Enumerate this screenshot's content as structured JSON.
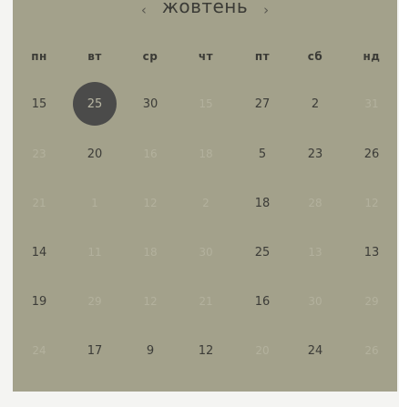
{
  "header": {
    "prev_label": "‹",
    "next_label": "›",
    "month": "жовтень"
  },
  "weekdays": [
    "пн",
    "вт",
    "ср",
    "чт",
    "пт",
    "сб",
    "нд"
  ],
  "weeks": [
    [
      {
        "d": "15",
        "m": false
      },
      {
        "d": "25",
        "m": false,
        "sel": true
      },
      {
        "d": "30",
        "m": false
      },
      {
        "d": "15",
        "m": true
      },
      {
        "d": "27",
        "m": false
      },
      {
        "d": "2",
        "m": false
      },
      {
        "d": "31",
        "m": true
      }
    ],
    [
      {
        "d": "23",
        "m": true
      },
      {
        "d": "20",
        "m": false
      },
      {
        "d": "16",
        "m": true
      },
      {
        "d": "18",
        "m": true
      },
      {
        "d": "5",
        "m": false
      },
      {
        "d": "23",
        "m": false
      },
      {
        "d": "26",
        "m": false
      }
    ],
    [
      {
        "d": "21",
        "m": true
      },
      {
        "d": "1",
        "m": true
      },
      {
        "d": "12",
        "m": true
      },
      {
        "d": "2",
        "m": true
      },
      {
        "d": "18",
        "m": false
      },
      {
        "d": "28",
        "m": true
      },
      {
        "d": "12",
        "m": true
      }
    ],
    [
      {
        "d": "14",
        "m": false
      },
      {
        "d": "11",
        "m": true
      },
      {
        "d": "18",
        "m": true
      },
      {
        "d": "30",
        "m": true
      },
      {
        "d": "25",
        "m": false
      },
      {
        "d": "13",
        "m": true
      },
      {
        "d": "13",
        "m": false
      }
    ],
    [
      {
        "d": "19",
        "m": false
      },
      {
        "d": "29",
        "m": true
      },
      {
        "d": "12",
        "m": true
      },
      {
        "d": "21",
        "m": true
      },
      {
        "d": "16",
        "m": false
      },
      {
        "d": "30",
        "m": true
      },
      {
        "d": "29",
        "m": true
      }
    ],
    [
      {
        "d": "24",
        "m": true
      },
      {
        "d": "17",
        "m": false
      },
      {
        "d": "9",
        "m": false
      },
      {
        "d": "12",
        "m": false
      },
      {
        "d": "20",
        "m": true
      },
      {
        "d": "24",
        "m": false
      },
      {
        "d": "26",
        "m": true
      }
    ]
  ],
  "colors": {
    "panel": "#a3a18b",
    "selected_circle": "#4b4b4a",
    "text": "#3c3c38",
    "muted_text": "#b3b19d"
  }
}
